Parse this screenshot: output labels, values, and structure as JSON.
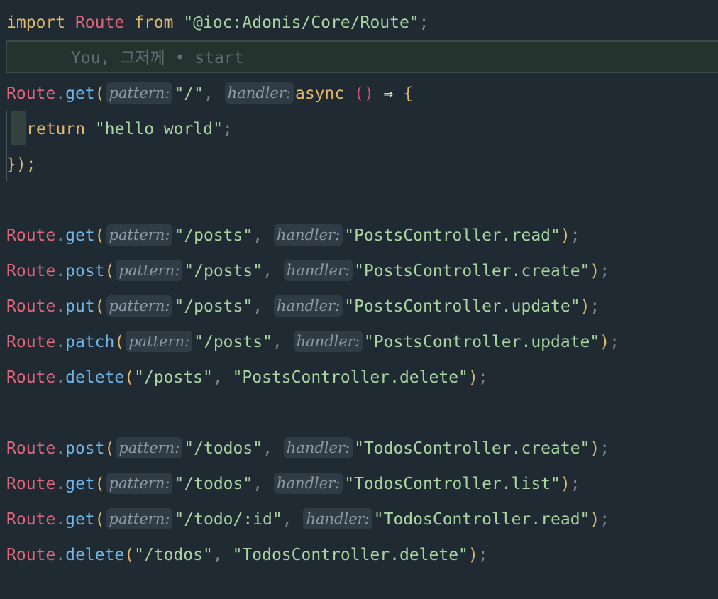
{
  "colors": {
    "background": "#1f2a33",
    "keyword": "#e0b86b",
    "object": "#e0657a",
    "method": "#6fb6e8",
    "string": "#a9d4a0",
    "hint_bg": "#2f3b45"
  },
  "import_line": {
    "kw_import": "import",
    "name": "Route",
    "kw_from": "from",
    "path": "\"@ioc:Adonis/Core/Route\"",
    "semi": ";"
  },
  "blame": {
    "text": "You, 그저께 • start"
  },
  "hints": {
    "pattern": "pattern:",
    "handler": "handler:"
  },
  "hello_route": {
    "obj": "Route",
    "method": "get",
    "pattern": "\"/\"",
    "async": "async",
    "arrow": "⇒",
    "return_kw": "return",
    "return_value": "\"hello world\"",
    "close": "});"
  },
  "routes": [
    {
      "obj": "Route",
      "method": "get",
      "path": "\"/posts\"",
      "handler": "\"PostsController.read\"",
      "hints": true
    },
    {
      "obj": "Route",
      "method": "post",
      "path": "\"/posts\"",
      "handler": "\"PostsController.create\"",
      "hints": true
    },
    {
      "obj": "Route",
      "method": "put",
      "path": "\"/posts\"",
      "handler": "\"PostsController.update\"",
      "hints": true
    },
    {
      "obj": "Route",
      "method": "patch",
      "path": "\"/posts\"",
      "handler": "\"PostsController.update\"",
      "hints": true
    },
    {
      "obj": "Route",
      "method": "delete",
      "path": "\"/posts\"",
      "handler": "\"PostsController.delete\"",
      "hints": false
    },
    {
      "obj": "Route",
      "method": "post",
      "path": "\"/todos\"",
      "handler": "\"TodosController.create\"",
      "hints": true
    },
    {
      "obj": "Route",
      "method": "get",
      "path": "\"/todos\"",
      "handler": "\"TodosController.list\"",
      "hints": true
    },
    {
      "obj": "Route",
      "method": "get",
      "path": "\"/todo/:id\"",
      "handler": "\"TodosController.read\"",
      "hints": true
    },
    {
      "obj": "Route",
      "method": "delete",
      "path": "\"/todos\"",
      "handler": "\"TodosController.delete\"",
      "hints": false
    }
  ]
}
